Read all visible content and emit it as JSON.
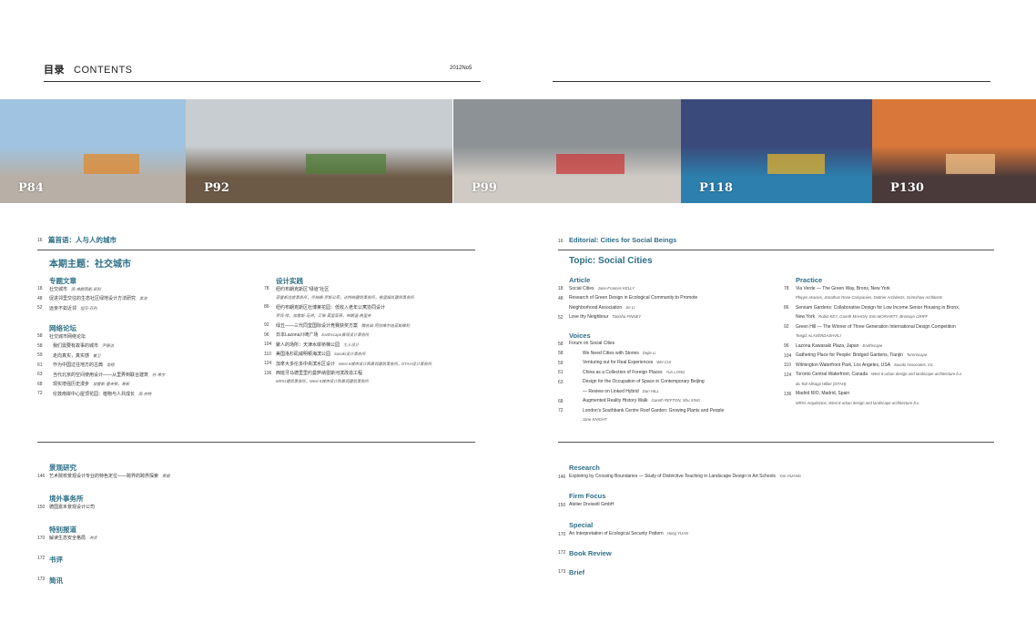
{
  "header": {
    "title_cn": "目录",
    "title_en": "CONTENTS",
    "issue": "2012No5"
  },
  "photos": [
    {
      "label": "P84",
      "sky": "#9fc3e0",
      "ground": "#b8b0a6",
      "accent": "#e08a2e"
    },
    {
      "label": "P92",
      "sky": "#c7cdd1",
      "ground": "#6c5a46",
      "accent": "#4f7d3a"
    },
    {
      "label": "P99",
      "sky": "#8d9296",
      "ground": "#cfcac4",
      "accent": "#c93a3a"
    },
    {
      "label": "P118",
      "sky": "#3a4a7a",
      "ground": "#2d7fae",
      "accent": "#e0b02c"
    },
    {
      "label": "P130",
      "sky": "#d9773a",
      "ground": "#4a3a3a",
      "accent": "#f2c38a"
    }
  ],
  "cn": {
    "editorial": {
      "page": "16",
      "text": "篇首语：人与人的城市"
    },
    "topic": "本期主题：社交城市",
    "col1": [
      {
        "type": "head",
        "text": "专题文章"
      },
      {
        "page": "18",
        "text": "社交城市",
        "author": "简·弗朗西斯·凯利"
      },
      {
        "page": "48",
        "text": "促进邻里交往的生态社区绿地设计方法研究",
        "author": "李洁"
      },
      {
        "page": "52",
        "text": "远亲不如近邻",
        "author": "坦莎·芬利"
      },
      {
        "type": "head",
        "text": "网络论坛"
      },
      {
        "page": "58",
        "text": "社交城市网络论坛"
      },
      {
        "page": "58",
        "text": "我们需要有故事的城市",
        "author": "尹德洁",
        "indent": true
      },
      {
        "page": "59",
        "text": "走向真实，真实感",
        "author": "崔卫",
        "indent": true
      },
      {
        "page": "61",
        "text": "作为中国过往地方的古典",
        "author": "龙翔",
        "indent": true
      },
      {
        "page": "63",
        "text": "当代北京的空间使用设计——从里弄到联合建筑",
        "author": "丹·希尔",
        "indent": true
      },
      {
        "page": "68",
        "text": "现实增强历史漫步",
        "author": "加雷斯·雷夫顿，寿新",
        "indent": true
      },
      {
        "page": "72",
        "text": "伦敦南岸中心屋顶花园：植物与人共成长",
        "author": "简·奈特",
        "indent": true
      }
    ],
    "col2": [
      {
        "type": "head",
        "text": "设计实践"
      },
      {
        "page": "78",
        "text": "纽约布朗克斯区“绿道”社区",
        "sub": "菲普斯住房事务所，乔纳森·罗斯公司，达特纳建筑事务所，格里姆肖建筑事务所"
      },
      {
        "page": "86",
        "text": "纽约布朗克斯区杜博莱花园：低收入老年公寓协同设计",
        "sub": "罗宾·哈，加雷斯·马洪，艾琳·莫里亚蒂，布朗温·格里夫"
      },
      {
        "page": "92",
        "text": "绿丘——三代同堂国际设计竞赛获奖方案",
        "author": "腾吉兹·阿拉维尔迪亚斯维利"
      },
      {
        "page": "96",
        "text": "日本Lazona川崎广场",
        "author": "Earthscape景观设计事务所"
      },
      {
        "page": "104",
        "text": "聚人的场所：天津水岸桥梯公园",
        "author": "土人设计"
      },
      {
        "page": "110",
        "text": "美国洛杉矶威明顿海滨公园",
        "author": "Sasaki设计事务所"
      },
      {
        "page": "124",
        "text": "加拿大多伦多中央滨水区设计",
        "author": "West 8城市设计和景观建筑事务所，DTAH设计事务所"
      },
      {
        "page": "136",
        "text": "西班牙马德里里约曼萨纳雷斯河滨改造工程",
        "sub": "MRIO建筑事务所，West 8城市设计和景观建筑事务所"
      }
    ],
    "bottom": [
      {
        "head": "景观研究",
        "page": "146",
        "text": "艺术院校景观设计专业的特色定位——跨界的跨界探索",
        "author": "黄健"
      },
      {
        "head": "境外事务所",
        "page": "150",
        "text": "德国嘉禾景观设计公司"
      },
      {
        "head": "特别报道",
        "page": "170",
        "text": "解读生态安全格局",
        "author": "洪贞"
      },
      {
        "head": "书评",
        "page": "172"
      },
      {
        "head": "简讯",
        "page": "173"
      }
    ]
  },
  "en": {
    "editorial": {
      "page": "16",
      "text": "Editorial: Cities for Social Beings"
    },
    "topic": "Topic:  Social Cities",
    "col1": [
      {
        "type": "head",
        "text": "Article"
      },
      {
        "page": "18",
        "text": "Social Cities",
        "author": "Jane-Frances KELLY"
      },
      {
        "page": "48",
        "text": "Research of Green Design in Ecological Community to Promote"
      },
      {
        "text": "Neighborhood Association",
        "author": "Jie LI"
      },
      {
        "page": "52",
        "text": "Love thy Neighbour",
        "author": "Tanisha FINNEY"
      },
      {
        "type": "head",
        "text": "Voices"
      },
      {
        "page": "58",
        "text": "Forum on Social Cities"
      },
      {
        "page": "58",
        "text": "We Need Cities with Stories",
        "author": "Dejie Li",
        "indent": true
      },
      {
        "page": "59",
        "text": "Venturing out for Real Experiences",
        "author": "Wei CUI",
        "indent": true
      },
      {
        "page": "61",
        "text": "China as a Collection of Foreign Places",
        "author": "Yun LONG",
        "indent": true
      },
      {
        "page": "63",
        "text": "Design for the Occupation of Space in Contemporary Beijing",
        "indent": true
      },
      {
        "text": "— Review on Linked Hybrid",
        "author": "Dan HILL",
        "indent2": true
      },
      {
        "page": "68",
        "text": "Augmented Reality History Walk",
        "author": "Gareth REFTON, Shu XING",
        "indent": true
      },
      {
        "page": "72",
        "text": "London's Southbank Centre Roof Garden: Growing Plants and People",
        "indent": true
      },
      {
        "sub": "Jane KNIGHT",
        "indent": true
      }
    ],
    "col2": [
      {
        "type": "head",
        "text": "Practice"
      },
      {
        "page": "78",
        "text": "Via Verde — The Green Way, Bronx, New York"
      },
      {
        "sub": "Phipps Houses, Jonathan Rose Companies, Dattner Architects, Grimshaw Architects"
      },
      {
        "page": "86",
        "text": "Serviam Gardens: Collaborative Design for Low Income Senior Housing in Bronx,"
      },
      {
        "text": "New York",
        "author": "Robin KEY, Gareth MAHON, Erin MORIARTY, Bronwyn GRIFF"
      },
      {
        "page": "92",
        "text": "Green Hill — The Winner of Three Generation International Design Competition"
      },
      {
        "sub": "Tengiz ALAVERDASHVILI"
      },
      {
        "page": "96",
        "text": "Lazona Kawasaki Plaza, Japan",
        "author": "Earthscape"
      },
      {
        "page": "104",
        "text": "Gathering Place for People: Bridged Gardens, Tianjin",
        "author": "Turenscape"
      },
      {
        "page": "110",
        "text": "Wilmington Waterfront Park, Los Angeles, USA",
        "author": "Sasaki Associates, Inc."
      },
      {
        "page": "124",
        "text": "Toronto Central Waterfront, Canada",
        "author": "West 8 urban design and landscape architecture b.v."
      },
      {
        "sub": "du Toit Allsopp Hillier (DTAH)"
      },
      {
        "page": "136",
        "text": "Madrid RIO, Madrid, Spain"
      },
      {
        "sub": "MRIO Arquitectos, West 8 urban design and landscape architecture b.v."
      }
    ],
    "bottom": [
      {
        "head": "Research",
        "page": "146",
        "text": "Exploring by Crossing Boundaries — Study of Distinctive Teaching in Landscape Design in Art Schools",
        "author": "Yan HUANG"
      },
      {
        "head": "Firm Focus",
        "page": "150",
        "text": "Atelier Dreiseitl GmbH"
      },
      {
        "head": "Special",
        "page": "170",
        "text": "An Interpretation of Ecological Security Pattern",
        "author": "Hong YUAN"
      },
      {
        "head": "Book Review",
        "page": "172"
      },
      {
        "head": "Brief",
        "page": "173"
      }
    ]
  }
}
